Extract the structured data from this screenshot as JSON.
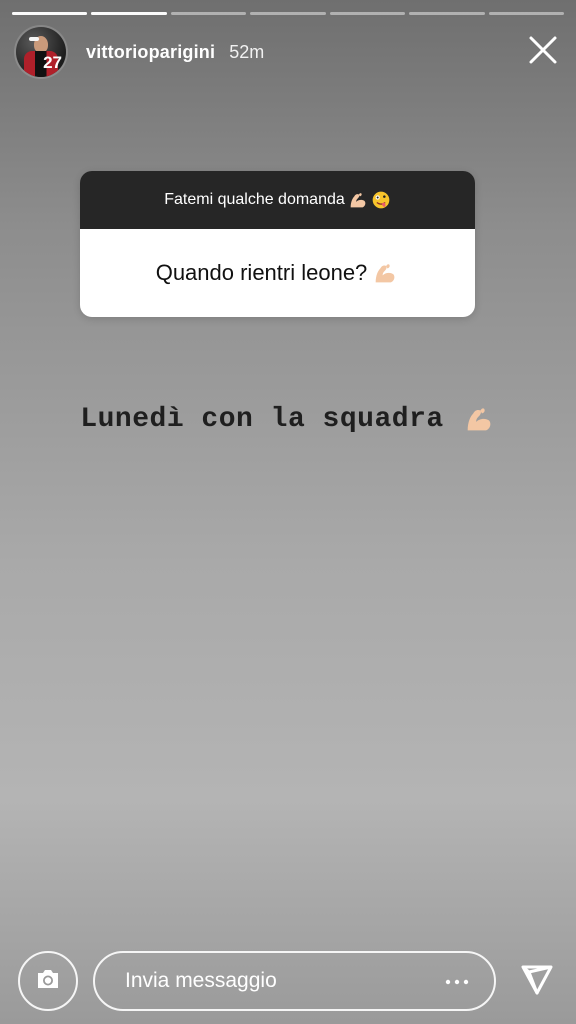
{
  "story": {
    "progress": {
      "segments": 7,
      "completed": 2
    },
    "header": {
      "username": "vittorioparigini",
      "time": "52m",
      "avatar_number": "27",
      "close_icon": "close-icon"
    },
    "question_sticker": {
      "prompt": "Fatemi qualche domanda",
      "prompt_emojis": [
        "flexed-biceps-icon",
        "zany-face-icon"
      ],
      "question": "Quando rientri leone?",
      "question_emoji": "flexed-biceps-icon"
    },
    "answer": {
      "text": "Lunedì con la squadra",
      "emoji": "flexed-biceps-icon"
    },
    "bottom_bar": {
      "camera_icon": "camera-icon",
      "message_placeholder": "Invia messaggio",
      "more_icon": "more-icon",
      "send_icon": "send-icon"
    },
    "colors": {
      "sticker_header": "#262626",
      "sticker_body": "#ffffff",
      "white": "#ffffff",
      "answer_text": "#1f1f1f"
    }
  }
}
